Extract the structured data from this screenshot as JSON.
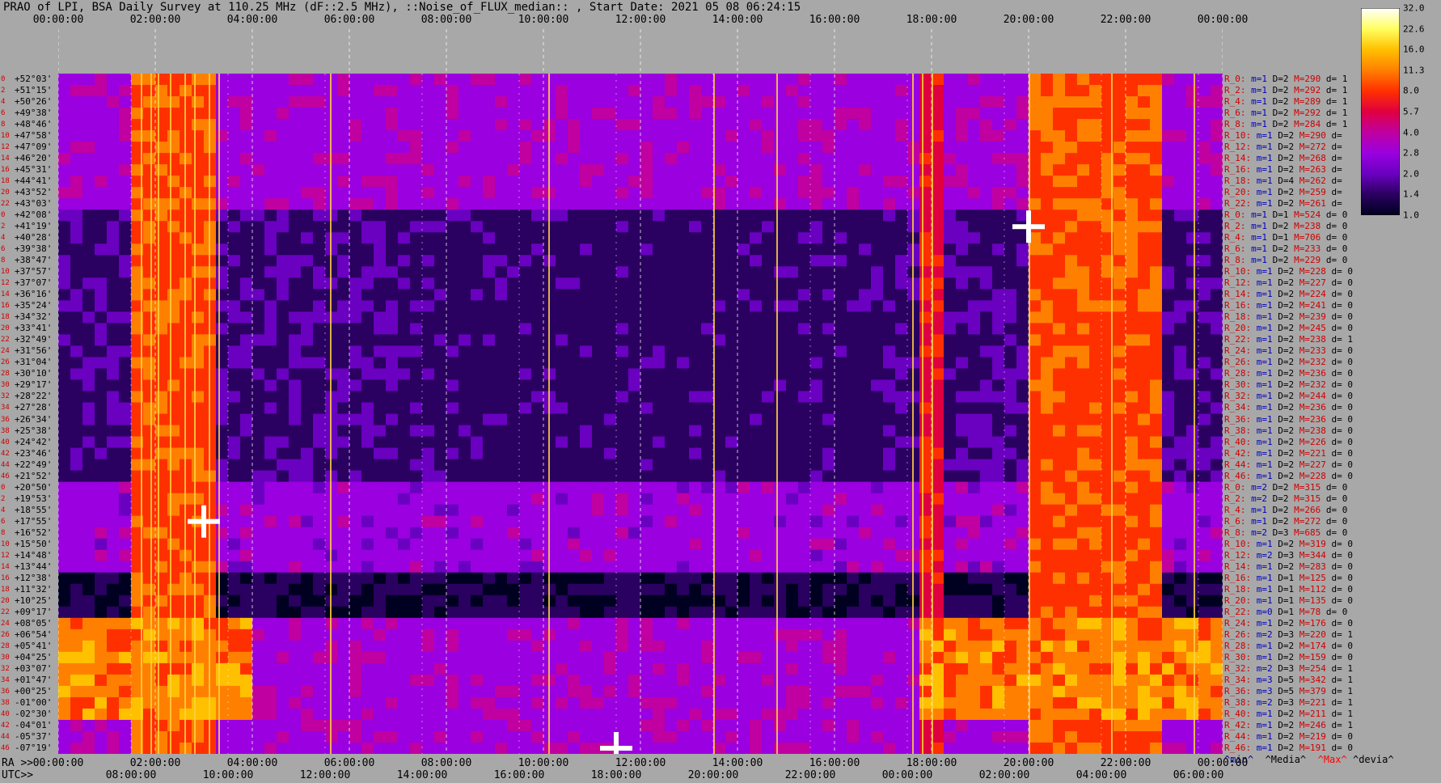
{
  "title": "PRAO of LPI, BSA Daily Survey at 110.25 MHz (dF::2.5 MHz), ::Noise_of_FLUX_median:: , Start Date: 2021 05 08 06:24:15",
  "chart_data": {
    "type": "heatmap",
    "title": "PRAO of LPI, BSA Daily Survey at 110.25 MHz (dF::2.5 MHz), ::Noise_of_FLUX_median:: , Start Date: 2021 05 08 06:24:15",
    "x_top_label": "",
    "x_top_ticks": [
      "00:00:00",
      "02:00:00",
      "04:00:00",
      "06:00:00",
      "08:00:00",
      "10:00:00",
      "12:00:00",
      "14:00:00",
      "16:00:00",
      "18:00:00",
      "20:00:00",
      "22:00:00",
      "00:00:00"
    ],
    "ra_label": "RA >>",
    "ra_ticks": [
      "00:00:00",
      "02:00:00",
      "04:00:00",
      "06:00:00",
      "08:00:00",
      "10:00:00",
      "12:00:00",
      "14:00:00",
      "16:00:00",
      "18:00:00",
      "20:00:00",
      "22:00:00",
      "00:00:00"
    ],
    "utc_label": "UTC>>",
    "utc_ticks": [
      "08:00:00",
      "10:00:00",
      "12:00:00",
      "14:00:00",
      "16:00:00",
      "18:00:00",
      "20:00:00",
      "22:00:00",
      "00:00:00",
      "02:00:00",
      "04:00:00",
      "06:00:00"
    ],
    "colorbar": {
      "ticks": [
        "32.0",
        "22.6",
        "16.0",
        "11.3",
        "8.0",
        "5.7",
        "4.0",
        "2.8",
        "2.0",
        "1.4",
        "1.0"
      ],
      "scale": "log",
      "range": [
        1.0,
        32.0
      ],
      "colors": [
        "#000020",
        "#2a0060",
        "#6a00c0",
        "#9a00e0",
        "#c000a0",
        "#e00040",
        "#ff3000",
        "#ff8000",
        "#ffc000",
        "#ffff60",
        "#ffffff"
      ]
    },
    "declinations": [
      "+52°03'",
      "+51°15'",
      "+50°26'",
      "+49°38'",
      "+48°46'",
      "+47°58'",
      "+47°09'",
      "+46°20'",
      "+45°31'",
      "+44°41'",
      "+43°52'",
      "+43°03'",
      "+42°08'",
      "+41°19'",
      "+40°28'",
      "+39°38'",
      "+38°47'",
      "+37°57'",
      "+37°07'",
      "+36°16'",
      "+35°24'",
      "+34°32'",
      "+33°41'",
      "+32°49'",
      "+31°56'",
      "+31°04'",
      "+30°10'",
      "+29°17'",
      "+28°22'",
      "+27°28'",
      "+26°34'",
      "+25°38'",
      "+24°42'",
      "+23°46'",
      "+22°49'",
      "+21°52'",
      "+20°50'",
      "+19°53'",
      "+18°55'",
      "+17°55'",
      "+16°52'",
      "+15°50'",
      "+14°48'",
      "+13°44'",
      "+12°38'",
      "+11°32'",
      "+10°25'",
      "+09°17'",
      "+08°05'",
      "+06°54'",
      "+05°41'",
      "+04°25'",
      "+03°07'",
      "+01°47'",
      "+00°25'",
      "-01°00'",
      "-02°30'",
      "-04°01'",
      "-05°37'",
      "-07°19'"
    ],
    "row_indices": [
      "0",
      "2",
      "4",
      "6",
      "8",
      "10",
      "12",
      "14",
      "16",
      "18",
      "20",
      "22",
      "0",
      "2",
      "4",
      "6",
      "8",
      "10",
      "12",
      "14",
      "16",
      "18",
      "20",
      "22",
      "24",
      "26",
      "28",
      "30",
      "32",
      "34",
      "36",
      "38",
      "40",
      "42",
      "44",
      "46",
      "0",
      "2",
      "4",
      "6",
      "8",
      "10",
      "12",
      "14",
      "16",
      "18",
      "20",
      "22",
      "24",
      "26",
      "28",
      "30",
      "32",
      "34",
      "36",
      "38",
      "40",
      "42",
      "44",
      "46"
    ],
    "bright_columns_ra_hours": [
      1.7,
      1.9,
      2.05,
      2.3,
      2.6,
      2.8,
      3.1,
      3.3,
      5.6,
      10.1,
      13.5,
      14.8,
      17.6,
      17.8,
      18.0,
      20.0,
      21.7,
      23.4
    ],
    "bright_bands": [
      {
        "ra_start": 1.5,
        "ra_end": 3.2,
        "level": 7
      },
      {
        "ra_start": 20.0,
        "ra_end": 22.5,
        "level": 7
      },
      {
        "ra_start": 17.6,
        "ra_end": 18.1,
        "level": 6
      }
    ],
    "point_sources": [
      {
        "ra_hours": 3.0,
        "dec": "+17°55'"
      },
      {
        "ra_hours": 20.0,
        "dec": "+41°19'"
      },
      {
        "ra_hours": 11.5,
        "dec": "-07°19'"
      }
    ]
  },
  "stats": [
    {
      "r": "R_0:",
      "m": "m=1",
      "d": "D=2",
      "h": "M=290",
      "dev": "d= 1"
    },
    {
      "r": "R_2:",
      "m": "m=1",
      "d": "D=2",
      "h": "M=292",
      "dev": "d= 1"
    },
    {
      "r": "R_4:",
      "m": "m=1",
      "d": "D=2",
      "h": "M=289",
      "dev": "d= 1"
    },
    {
      "r": "R_6:",
      "m": "m=1",
      "d": "D=2",
      "h": "M=292",
      "dev": "d= 1"
    },
    {
      "r": "R_8:",
      "m": "m=1",
      "d": "D=2",
      "h": "M=284",
      "dev": "d= 1"
    },
    {
      "r": "R_10:",
      "m": "m=1",
      "d": "D=2",
      "h": "M=290",
      "dev": "d="
    },
    {
      "r": "R_12:",
      "m": "m=1",
      "d": "D=2",
      "h": "M=272",
      "dev": "d="
    },
    {
      "r": "R_14:",
      "m": "m=1",
      "d": "D=2",
      "h": "M=268",
      "dev": "d="
    },
    {
      "r": "R_16:",
      "m": "m=1",
      "d": "D=2",
      "h": "M=263",
      "dev": "d="
    },
    {
      "r": "R_18:",
      "m": "m=1",
      "d": "D=4",
      "h": "M=262",
      "dev": "d="
    },
    {
      "r": "R_20:",
      "m": "m=1",
      "d": "D=2",
      "h": "M=259",
      "dev": "d="
    },
    {
      "r": "R_22:",
      "m": "m=1",
      "d": "D=2",
      "h": "M=261",
      "dev": "d="
    },
    {
      "r": "R_0:",
      "m": "m=1",
      "d": "D=1",
      "h": "M=524",
      "dev": "d= 0"
    },
    {
      "r": "R_2:",
      "m": "m=1",
      "d": "D=2",
      "h": "M=238",
      "dev": "d= 0"
    },
    {
      "r": "R_4:",
      "m": "m=1",
      "d": "D=1",
      "h": "M=706",
      "dev": "d= 0"
    },
    {
      "r": "R_6:",
      "m": "m=1",
      "d": "D=2",
      "h": "M=233",
      "dev": "d= 0"
    },
    {
      "r": "R_8:",
      "m": "m=1",
      "d": "D=2",
      "h": "M=229",
      "dev": "d= 0"
    },
    {
      "r": "R_10:",
      "m": "m=1",
      "d": "D=2",
      "h": "M=228",
      "dev": "d= 0"
    },
    {
      "r": "R_12:",
      "m": "m=1",
      "d": "D=2",
      "h": "M=227",
      "dev": "d= 0"
    },
    {
      "r": "R_14:",
      "m": "m=1",
      "d": "D=2",
      "h": "M=224",
      "dev": "d= 0"
    },
    {
      "r": "R_16:",
      "m": "m=1",
      "d": "D=2",
      "h": "M=241",
      "dev": "d= 0"
    },
    {
      "r": "R_18:",
      "m": "m=1",
      "d": "D=2",
      "h": "M=239",
      "dev": "d= 0"
    },
    {
      "r": "R_20:",
      "m": "m=1",
      "d": "D=2",
      "h": "M=245",
      "dev": "d= 0"
    },
    {
      "r": "R_22:",
      "m": "m=1",
      "d": "D=2",
      "h": "M=238",
      "dev": "d= 1"
    },
    {
      "r": "R_24:",
      "m": "m=1",
      "d": "D=2",
      "h": "M=233",
      "dev": "d= 0"
    },
    {
      "r": "R_26:",
      "m": "m=1",
      "d": "D=2",
      "h": "M=232",
      "dev": "d= 0"
    },
    {
      "r": "R_28:",
      "m": "m=1",
      "d": "D=2",
      "h": "M=236",
      "dev": "d= 0"
    },
    {
      "r": "R_30:",
      "m": "m=1",
      "d": "D=2",
      "h": "M=232",
      "dev": "d= 0"
    },
    {
      "r": "R_32:",
      "m": "m=1",
      "d": "D=2",
      "h": "M=244",
      "dev": "d= 0"
    },
    {
      "r": "R_34:",
      "m": "m=1",
      "d": "D=2",
      "h": "M=236",
      "dev": "d= 0"
    },
    {
      "r": "R_36:",
      "m": "m=1",
      "d": "D=2",
      "h": "M=236",
      "dev": "d= 0"
    },
    {
      "r": "R_38:",
      "m": "m=1",
      "d": "D=2",
      "h": "M=238",
      "dev": "d= 0"
    },
    {
      "r": "R_40:",
      "m": "m=1",
      "d": "D=2",
      "h": "M=226",
      "dev": "d= 0"
    },
    {
      "r": "R_42:",
      "m": "m=1",
      "d": "D=2",
      "h": "M=221",
      "dev": "d= 0"
    },
    {
      "r": "R_44:",
      "m": "m=1",
      "d": "D=2",
      "h": "M=227",
      "dev": "d= 0"
    },
    {
      "r": "R_46:",
      "m": "m=1",
      "d": "D=2",
      "h": "M=228",
      "dev": "d= 0"
    },
    {
      "r": "R_0:",
      "m": "m=2",
      "d": "D=2",
      "h": "M=315",
      "dev": "d= 0"
    },
    {
      "r": "R_2:",
      "m": "m=2",
      "d": "D=2",
      "h": "M=315",
      "dev": "d= 0"
    },
    {
      "r": "R_4:",
      "m": "m=1",
      "d": "D=2",
      "h": "M=266",
      "dev": "d= 0"
    },
    {
      "r": "R_6:",
      "m": "m=1",
      "d": "D=2",
      "h": "M=272",
      "dev": "d= 0"
    },
    {
      "r": "R_8:",
      "m": "m=2",
      "d": "D=3",
      "h": "M=685",
      "dev": "d= 0"
    },
    {
      "r": "R_10:",
      "m": "m=1",
      "d": "D=2",
      "h": "M=319",
      "dev": "d= 0"
    },
    {
      "r": "R_12:",
      "m": "m=2",
      "d": "D=3",
      "h": "M=344",
      "dev": "d= 0"
    },
    {
      "r": "R_14:",
      "m": "m=1",
      "d": "D=2",
      "h": "M=283",
      "dev": "d= 0"
    },
    {
      "r": "R_16:",
      "m": "m=1",
      "d": "D=1",
      "h": "M=125",
      "dev": "d= 0"
    },
    {
      "r": "R_18:",
      "m": "m=1",
      "d": "D=1",
      "h": "M=112",
      "dev": "d= 0"
    },
    {
      "r": "R_20:",
      "m": "m=1",
      "d": "D=1",
      "h": "M=135",
      "dev": "d= 0"
    },
    {
      "r": "R_22:",
      "m": "m=0",
      "d": "D=1",
      "h": "M=78",
      "dev": "d= 0"
    },
    {
      "r": "R_24:",
      "m": "m=1",
      "d": "D=2",
      "h": "M=176",
      "dev": "d= 0"
    },
    {
      "r": "R_26:",
      "m": "m=2",
      "d": "D=3",
      "h": "M=220",
      "dev": "d= 1"
    },
    {
      "r": "R_28:",
      "m": "m=1",
      "d": "D=2",
      "h": "M=174",
      "dev": "d= 0"
    },
    {
      "r": "R_30:",
      "m": "m=1",
      "d": "D=2",
      "h": "M=159",
      "dev": "d= 0"
    },
    {
      "r": "R_32:",
      "m": "m=2",
      "d": "D=3",
      "h": "M=254",
      "dev": "d= 1"
    },
    {
      "r": "R_34:",
      "m": "m=3",
      "d": "D=5",
      "h": "M=342",
      "dev": "d= 1"
    },
    {
      "r": "R_36:",
      "m": "m=3",
      "d": "D=5",
      "h": "M=379",
      "dev": "d= 1"
    },
    {
      "r": "R_38:",
      "m": "m=2",
      "d": "D=3",
      "h": "M=221",
      "dev": "d= 1"
    },
    {
      "r": "R_40:",
      "m": "m=1",
      "d": "D=2",
      "h": "M=211",
      "dev": "d= 1"
    },
    {
      "r": "R_42:",
      "m": "m=1",
      "d": "D=2",
      "h": "M=246",
      "dev": "d= 1"
    },
    {
      "r": "R_44:",
      "m": "m=1",
      "d": "D=2",
      "h": "M=219",
      "dev": "d= 0"
    },
    {
      "r": "R_46:",
      "m": "m=1",
      "d": "D=2",
      "h": "M=191",
      "dev": "d= 0"
    }
  ],
  "stats_footer": {
    "min": "^min^",
    "median": "^Media^",
    "max": "^Max^",
    "dev": "^devia^"
  }
}
